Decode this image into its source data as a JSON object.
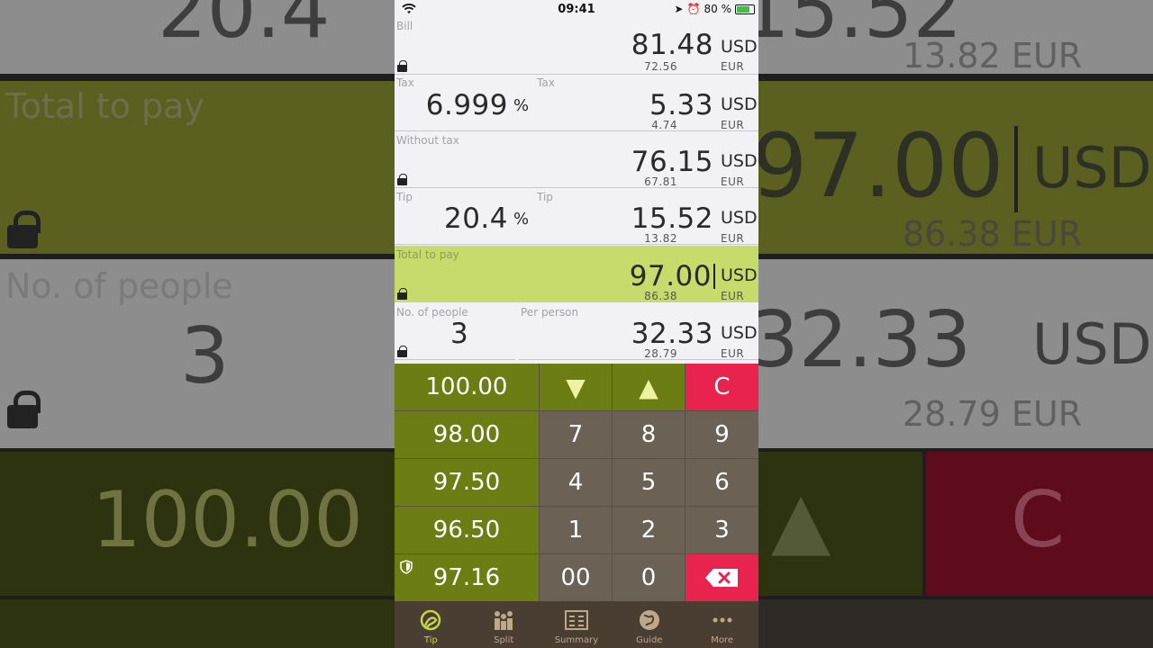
{
  "status": {
    "time": "09:41",
    "battery": "80 %"
  },
  "rows": {
    "bill": {
      "label": "Bill",
      "value": "81.48",
      "currency": "USD",
      "converted": "72.56",
      "converted_currency": "EUR"
    },
    "tax": {
      "label": "Tax",
      "percent": "6.999",
      "percent_sign": "%",
      "amount_label": "Tax",
      "value": "5.33",
      "currency": "USD",
      "converted": "4.74",
      "converted_currency": "EUR"
    },
    "without_tax": {
      "label": "Without tax",
      "value": "76.15",
      "currency": "USD",
      "converted": "67.81",
      "converted_currency": "EUR"
    },
    "tip": {
      "label": "Tip",
      "percent": "20.4",
      "percent_sign": "%",
      "amount_label": "Tip",
      "value": "15.52",
      "currency": "USD",
      "converted": "13.82",
      "converted_currency": "EUR"
    },
    "total": {
      "label": "Total to pay",
      "value": "97.00",
      "currency": "USD",
      "converted": "86.38",
      "converted_currency": "EUR"
    },
    "people": {
      "label": "No. of people",
      "count": "3",
      "per_label": "Per person",
      "value": "32.33",
      "currency": "USD",
      "converted": "28.79",
      "converted_currency": "EUR"
    }
  },
  "keypad": {
    "presets": [
      "100.00",
      "98.00",
      "97.50",
      "96.50",
      "97.16"
    ],
    "down": "▼",
    "up": "▲",
    "clear": "C",
    "digits": [
      "7",
      "8",
      "9",
      "4",
      "5",
      "6",
      "1",
      "2",
      "3",
      "00",
      "0"
    ]
  },
  "tabs": [
    {
      "label": "Tip",
      "icon": "tip-icon",
      "active": true
    },
    {
      "label": "Split",
      "icon": "split-icon",
      "active": false
    },
    {
      "label": "Summary",
      "icon": "summary-icon",
      "active": false
    },
    {
      "label": "Guide",
      "icon": "guide-icon",
      "active": false
    },
    {
      "label": "More",
      "icon": "more-icon",
      "active": false
    }
  ],
  "background": {
    "top_value": "20.4",
    "top_right_value": "15.52",
    "top_right_sub": "13.82 EUR",
    "total_label": "Total to pay",
    "total_value": "97.00",
    "total_currency": "USD",
    "total_sub": "86.38 EUR",
    "people_label": "No. of people",
    "people_count": "3",
    "per_value": "32.33",
    "per_currency": "USD",
    "per_sub": "28.79 EUR",
    "preset": "100.00",
    "up": "▲",
    "clear": "C"
  },
  "colors": {
    "highlight": "#c7db6c",
    "preset": "#6b7d13",
    "red": "#e8244e",
    "keypad": "#6b6155"
  }
}
